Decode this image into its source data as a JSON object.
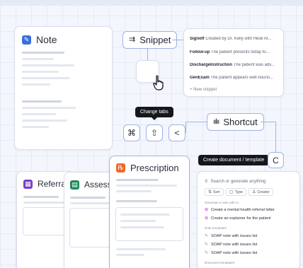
{
  "colors": {
    "note_icon": "#3a6fe0",
    "prescription_icon": "#ea6b2d",
    "referral_icon": "#7b3fc9",
    "assessment_icon": "#1f8a5a",
    "accent_border": "#9fb2e6",
    "tooltip_bg": "#15171c"
  },
  "note_card": {
    "title": "Note",
    "icon": "note-edit-icon"
  },
  "snippet_pill": {
    "label": "Snippet",
    "icon": "text-lines-icon"
  },
  "snippet_list": {
    "rows": [
      {
        "name": "Signoff",
        "preview": "Created by Dr. Kelly with Heidi AI..."
      },
      {
        "name": "Follow-up",
        "preview": "The patient presents today fo..."
      },
      {
        "name": "DischargeInstruction",
        "preview": "The patient was adv..."
      },
      {
        "name": "GenExam",
        "preview": "The patient appears well-nouris..."
      }
    ],
    "new_label": "+ New snippet"
  },
  "tooltip_change_tabs": "Change tabs",
  "keys": {
    "cmd": "⌘",
    "shift": "⇧",
    "back": "<",
    "c": "C"
  },
  "shortcut_pill": {
    "label": "Shortcut",
    "icon": "waveform-icon"
  },
  "tooltip_create_doc": "Create document / template",
  "prescription_card": {
    "title": "Prescription",
    "icon": "prescription-icon"
  },
  "referral_card": {
    "title": "Referral l",
    "icon": "referral-icon"
  },
  "assessment_card": {
    "title": "Assessm",
    "icon": "assessment-icon"
  },
  "palette": {
    "search_placeholder": "Search or generate anything",
    "chips": [
      "Sort",
      "Type",
      "Creator"
    ],
    "sections": {
      "ai": "Generate a note with AI",
      "notes": "Note templates",
      "docs": "Document templates"
    },
    "ai_items": [
      "Create a mental health referral letter",
      "Create an explainer for the patient"
    ],
    "note_items": [
      "SOAP note with issues list",
      "SOAP note with issues list",
      "SOAP note with issues list"
    ]
  }
}
